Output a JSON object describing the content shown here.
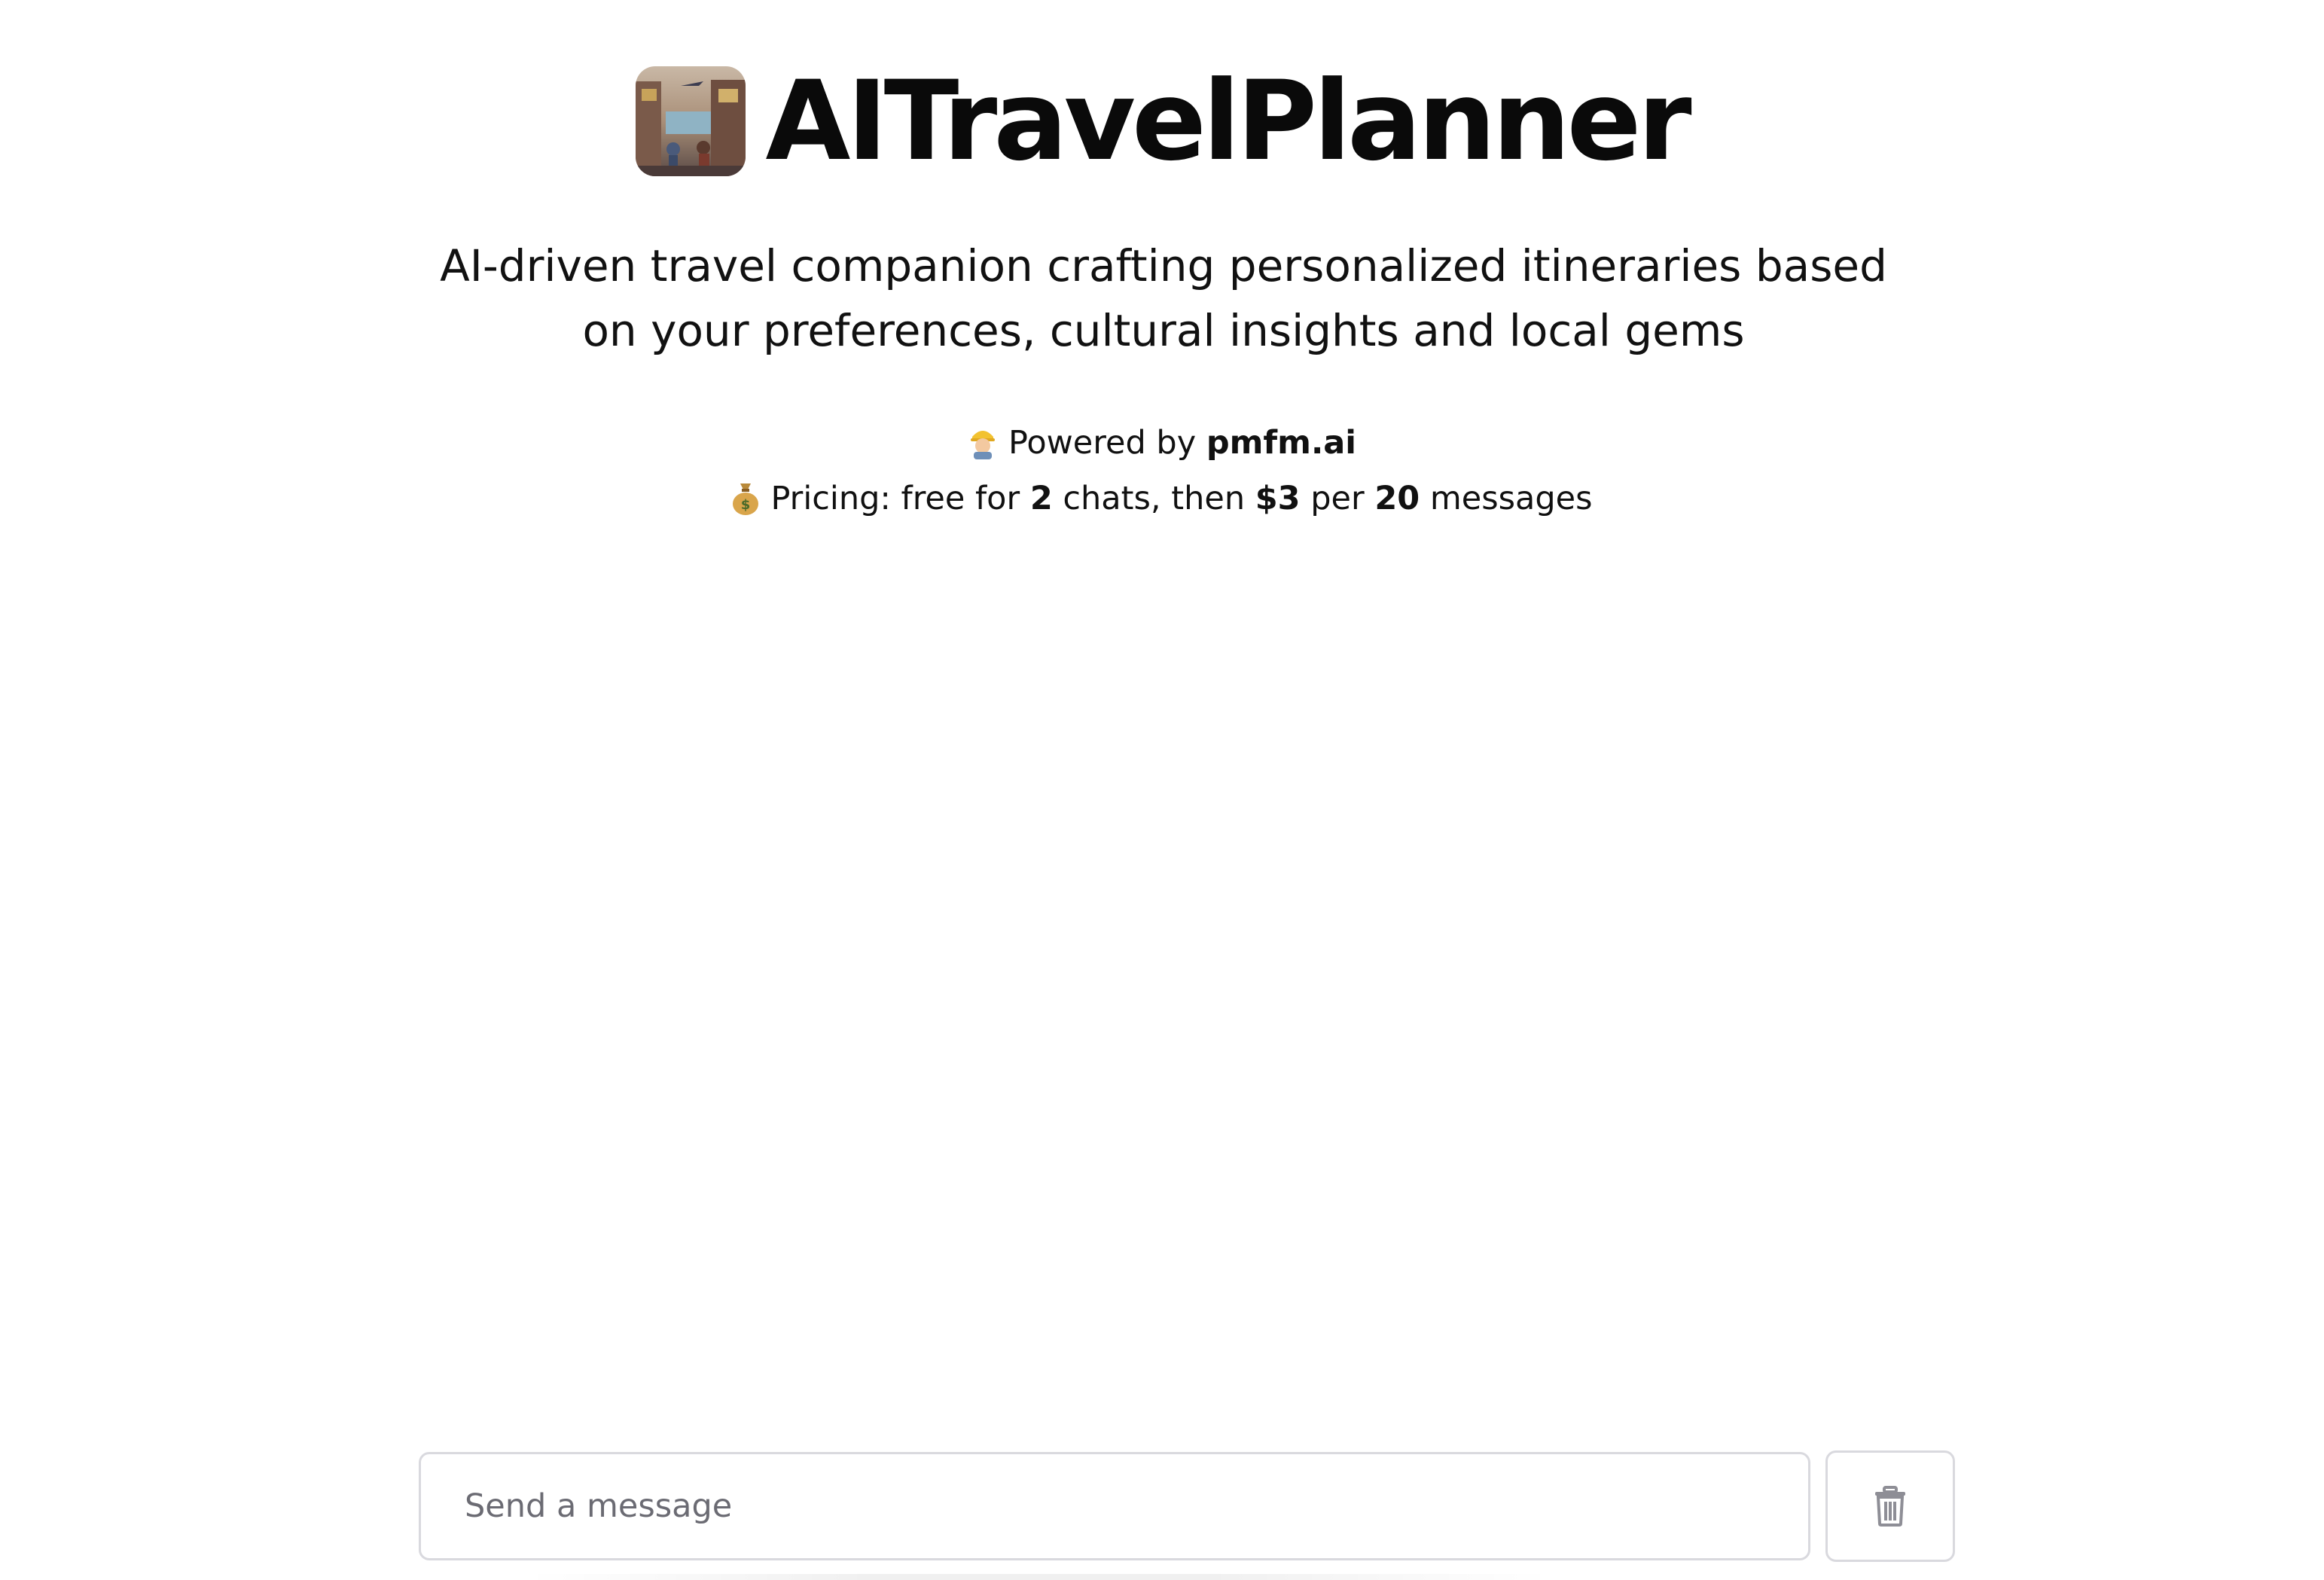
{
  "app": {
    "title": "AITravelPlanner",
    "logo_icon": "travel-scene-logo-icon"
  },
  "tagline": {
    "line1": "AI-driven travel companion crafting personalized itineraries based",
    "line2": "on your preferences, cultural insights and local gems"
  },
  "powered": {
    "emoji_icon": "worker-emoji-icon",
    "prefix": "Powered by ",
    "brand": "pmfm.ai"
  },
  "pricing": {
    "emoji_icon": "money-bag-emoji-icon",
    "prefix": "Pricing: free for ",
    "free_chats": "2",
    "mid": " chats, then ",
    "price": "$3",
    "per": " per ",
    "messages_count": "20",
    "suffix": " messages"
  },
  "composer": {
    "placeholder": "Send a message",
    "clear_icon": "trash-icon"
  },
  "colors": {
    "border": "#d9d9de",
    "placeholder": "#6b6b73",
    "icon": "#8e8e96"
  }
}
